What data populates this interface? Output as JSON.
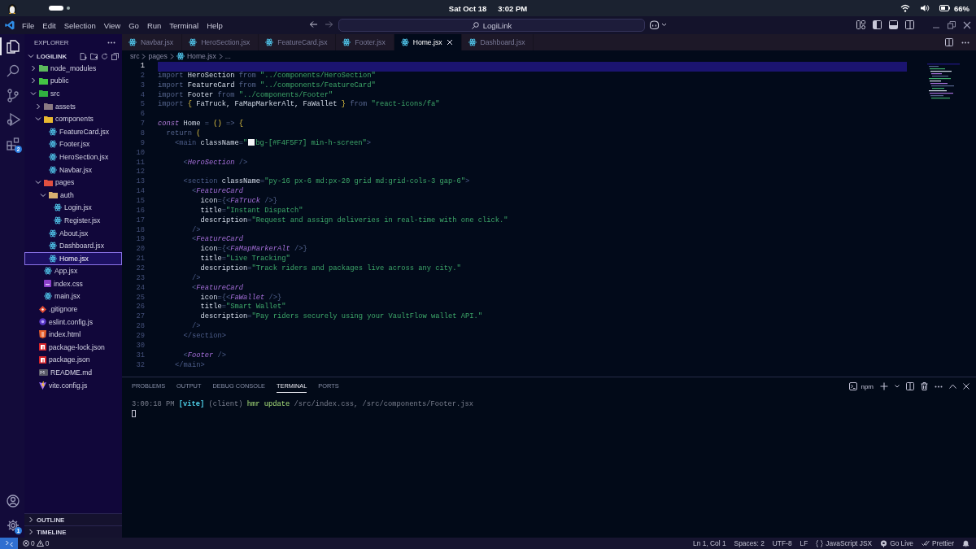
{
  "os_bar": {
    "date": "Sat Oct 18",
    "time": "3:02 PM",
    "battery": "66%"
  },
  "menu": [
    "File",
    "Edit",
    "Selection",
    "View",
    "Go",
    "Run",
    "Terminal",
    "Help"
  ],
  "command_center": {
    "label": "LogiLink"
  },
  "activity_bar": {
    "items": [
      {
        "kind": "explorer",
        "selected": true
      },
      {
        "kind": "search",
        "selected": false
      },
      {
        "kind": "source-control",
        "selected": false
      },
      {
        "kind": "run",
        "selected": false
      },
      {
        "kind": "extensions",
        "selected": false,
        "badge": "2"
      }
    ],
    "bottom": [
      {
        "kind": "account"
      },
      {
        "kind": "settings",
        "badge": "1"
      }
    ]
  },
  "explorer": {
    "title": "EXPLORER",
    "workspace": "LOGILINK",
    "tree": [
      {
        "name": "node_modules",
        "kind": "folder",
        "color": "#5cb85c",
        "expanded": false,
        "selected": false
      },
      {
        "name": "public",
        "kind": "folder",
        "color": "#44c444",
        "expanded": false,
        "selected": false
      },
      {
        "name": "src",
        "kind": "folder",
        "color": "#30b040",
        "expanded": true,
        "selected": false,
        "children": [
          {
            "name": "assets",
            "kind": "folder",
            "color": "#8a7a82",
            "expanded": false,
            "selected": false
          },
          {
            "name": "components",
            "kind": "folder",
            "color": "#e8b830",
            "expanded": true,
            "selected": false,
            "children": [
              {
                "name": "FeatureCard.jsx",
                "kind": "react",
                "selected": false
              },
              {
                "name": "Footer.jsx",
                "kind": "react",
                "selected": false
              },
              {
                "name": "HeroSection.jsx",
                "kind": "react",
                "selected": false
              },
              {
                "name": "Navbar.jsx",
                "kind": "react",
                "selected": false
              }
            ]
          },
          {
            "name": "pages",
            "kind": "folder",
            "color": "#e05040",
            "expanded": true,
            "selected": false,
            "children": [
              {
                "name": "auth",
                "kind": "folder",
                "color": "#d8b070",
                "expanded": true,
                "selected": false,
                "children": [
                  {
                    "name": "Login.jsx",
                    "kind": "react",
                    "selected": false
                  },
                  {
                    "name": "Register.jsx",
                    "kind": "react",
                    "selected": false
                  }
                ]
              },
              {
                "name": "About.jsx",
                "kind": "react",
                "selected": false
              },
              {
                "name": "Dashboard.jsx",
                "kind": "react",
                "selected": false
              },
              {
                "name": "Home.jsx",
                "kind": "react",
                "selected": true
              }
            ]
          },
          {
            "name": "App.jsx",
            "kind": "react",
            "selected": false
          },
          {
            "name": "index.css",
            "kind": "css",
            "selected": false
          },
          {
            "name": "main.jsx",
            "kind": "react",
            "selected": false
          }
        ]
      },
      {
        "name": ".gitignore",
        "kind": "git",
        "selected": false
      },
      {
        "name": "eslint.config.js",
        "kind": "eslint",
        "selected": false
      },
      {
        "name": "index.html",
        "kind": "html",
        "selected": false
      },
      {
        "name": "package-lock.json",
        "kind": "npm",
        "selected": false
      },
      {
        "name": "package.json",
        "kind": "npm",
        "selected": false
      },
      {
        "name": "README.md",
        "kind": "markdown",
        "selected": false
      },
      {
        "name": "vite.config.js",
        "kind": "vite",
        "selected": false
      }
    ],
    "sections": [
      {
        "label": "OUTLINE",
        "expanded": false
      },
      {
        "label": "TIMELINE",
        "expanded": false
      }
    ]
  },
  "tabs": [
    {
      "label": "Navbar.jsx",
      "selected": false
    },
    {
      "label": "HeroSection.jsx",
      "selected": false
    },
    {
      "label": "FeatureCard.jsx",
      "selected": false
    },
    {
      "label": "Footer.jsx",
      "selected": false
    },
    {
      "label": "Home.jsx",
      "selected": true
    },
    {
      "label": "Dashboard.jsx",
      "selected": false
    }
  ],
  "breadcrumb": [
    "src",
    "pages",
    "Home.jsx",
    "..."
  ],
  "editor": {
    "lines": [
      {
        "number": "1",
        "current": true
      },
      {
        "number": "2",
        "current": false,
        "tokens": [
          {
            "kind": "kw",
            "text": "import "
          },
          {
            "kind": "id",
            "text": "HeroSection "
          },
          {
            "kind": "kw",
            "text": "from "
          },
          {
            "kind": "str",
            "text": "\"../components/HeroSection\""
          }
        ]
      },
      {
        "number": "3",
        "current": false,
        "tokens": [
          {
            "kind": "kw",
            "text": "import "
          },
          {
            "kind": "id",
            "text": "FeatureCard "
          },
          {
            "kind": "kw",
            "text": "from "
          },
          {
            "kind": "str",
            "text": "\"../components/FeatureCard\""
          }
        ]
      },
      {
        "number": "4",
        "current": false,
        "tokens": [
          {
            "kind": "kw",
            "text": "import "
          },
          {
            "kind": "id",
            "text": "Footer "
          },
          {
            "kind": "kw",
            "text": "from "
          },
          {
            "kind": "str",
            "text": "\"../components/Footer\""
          }
        ]
      },
      {
        "number": "5",
        "current": false,
        "tokens": [
          {
            "kind": "kw",
            "text": "import "
          },
          {
            "kind": "brace",
            "text": "{ "
          },
          {
            "kind": "id",
            "text": "FaTruck, FaMapMarkerAlt, FaWallet "
          },
          {
            "kind": "brace",
            "text": "} "
          },
          {
            "kind": "kw",
            "text": "from "
          },
          {
            "kind": "str",
            "text": "\"react-icons/fa\""
          }
        ]
      },
      {
        "number": "6",
        "current": false
      },
      {
        "number": "7",
        "current": false,
        "tokens": [
          {
            "kind": "storage",
            "text": "const "
          },
          {
            "kind": "id",
            "text": "Home "
          },
          {
            "kind": "op",
            "text": "= "
          },
          {
            "kind": "brace",
            "text": "() "
          },
          {
            "kind": "op",
            "text": "=> "
          },
          {
            "kind": "brace",
            "text": "{"
          }
        ]
      },
      {
        "number": "8",
        "current": false,
        "tokens": [
          {
            "kind": "kw",
            "text": "  return "
          },
          {
            "kind": "brace",
            "text": "("
          }
        ]
      },
      {
        "number": "9",
        "current": false,
        "tokens": [
          {
            "kind": "tag",
            "text": "    <main "
          },
          {
            "kind": "attr",
            "text": "className"
          },
          {
            "kind": "op",
            "text": "="
          },
          {
            "kind": "str",
            "text": "\""
          },
          {
            "kind": "swatch",
            "color": "#f4f5f7"
          },
          {
            "kind": "str",
            "text": "bg-[#F4F5F7] min-h-screen\""
          },
          {
            "kind": "tag",
            "text": ">"
          }
        ]
      },
      {
        "number": "10",
        "current": false
      },
      {
        "number": "11",
        "current": false,
        "tokens": [
          {
            "kind": "tag",
            "text": "      <"
          },
          {
            "kind": "comp",
            "text": "HeroSection"
          },
          {
            "kind": "tag",
            "text": " />"
          }
        ]
      },
      {
        "number": "12",
        "current": false
      },
      {
        "number": "13",
        "current": false,
        "tokens": [
          {
            "kind": "tag",
            "text": "      <section "
          },
          {
            "kind": "attr",
            "text": "className"
          },
          {
            "kind": "op",
            "text": "="
          },
          {
            "kind": "str",
            "text": "\"py-16 px-6 md:px-20 grid md:grid-cols-3 gap-6\""
          },
          {
            "kind": "tag",
            "text": ">"
          }
        ]
      },
      {
        "number": "14",
        "current": false,
        "tokens": [
          {
            "kind": "tag",
            "text": "        <"
          },
          {
            "kind": "comp",
            "text": "FeatureCard"
          }
        ]
      },
      {
        "number": "15",
        "current": false,
        "tokens": [
          {
            "kind": "attr",
            "text": "          icon"
          },
          {
            "kind": "op",
            "text": "={"
          },
          {
            "kind": "tag",
            "text": "<"
          },
          {
            "kind": "comp",
            "text": "FaTruck"
          },
          {
            "kind": "tag",
            "text": " />"
          },
          {
            "kind": "op",
            "text": "}"
          }
        ]
      },
      {
        "number": "16",
        "current": false,
        "tokens": [
          {
            "kind": "attr",
            "text": "          title"
          },
          {
            "kind": "op",
            "text": "="
          },
          {
            "kind": "str",
            "text": "\"Instant Dispatch\""
          }
        ]
      },
      {
        "number": "17",
        "current": false,
        "tokens": [
          {
            "kind": "attr",
            "text": "          description"
          },
          {
            "kind": "op",
            "text": "="
          },
          {
            "kind": "str",
            "text": "\"Request and assign deliveries in real-time with one click.\""
          }
        ]
      },
      {
        "number": "18",
        "current": false,
        "tokens": [
          {
            "kind": "tag",
            "text": "        />"
          }
        ]
      },
      {
        "number": "19",
        "current": false,
        "tokens": [
          {
            "kind": "tag",
            "text": "        <"
          },
          {
            "kind": "comp",
            "text": "FeatureCard"
          }
        ]
      },
      {
        "number": "20",
        "current": false,
        "tokens": [
          {
            "kind": "attr",
            "text": "          icon"
          },
          {
            "kind": "op",
            "text": "={"
          },
          {
            "kind": "tag",
            "text": "<"
          },
          {
            "kind": "comp",
            "text": "FaMapMarkerAlt"
          },
          {
            "kind": "tag",
            "text": " />"
          },
          {
            "kind": "op",
            "text": "}"
          }
        ]
      },
      {
        "number": "21",
        "current": false,
        "tokens": [
          {
            "kind": "attr",
            "text": "          title"
          },
          {
            "kind": "op",
            "text": "="
          },
          {
            "kind": "str",
            "text": "\"Live Tracking\""
          }
        ]
      },
      {
        "number": "22",
        "current": false,
        "tokens": [
          {
            "kind": "attr",
            "text": "          description"
          },
          {
            "kind": "op",
            "text": "="
          },
          {
            "kind": "str",
            "text": "\"Track riders and packages live across any city.\""
          }
        ]
      },
      {
        "number": "23",
        "current": false,
        "tokens": [
          {
            "kind": "tag",
            "text": "        />"
          }
        ]
      },
      {
        "number": "24",
        "current": false,
        "tokens": [
          {
            "kind": "tag",
            "text": "        <"
          },
          {
            "kind": "comp",
            "text": "FeatureCard"
          }
        ]
      },
      {
        "number": "25",
        "current": false,
        "tokens": [
          {
            "kind": "attr",
            "text": "          icon"
          },
          {
            "kind": "op",
            "text": "={"
          },
          {
            "kind": "tag",
            "text": "<"
          },
          {
            "kind": "comp",
            "text": "FaWallet"
          },
          {
            "kind": "tag",
            "text": " />"
          },
          {
            "kind": "op",
            "text": "}"
          }
        ]
      },
      {
        "number": "26",
        "current": false,
        "tokens": [
          {
            "kind": "attr",
            "text": "          title"
          },
          {
            "kind": "op",
            "text": "="
          },
          {
            "kind": "str",
            "text": "\"Smart Wallet\""
          }
        ]
      },
      {
        "number": "27",
        "current": false,
        "tokens": [
          {
            "kind": "attr",
            "text": "          description"
          },
          {
            "kind": "op",
            "text": "="
          },
          {
            "kind": "str",
            "text": "\"Pay riders securely using your VaultFlow wallet API.\""
          }
        ]
      },
      {
        "number": "28",
        "current": false,
        "tokens": [
          {
            "kind": "tag",
            "text": "        />"
          }
        ]
      },
      {
        "number": "29",
        "current": false,
        "tokens": [
          {
            "kind": "tag",
            "text": "      </section>"
          }
        ]
      },
      {
        "number": "30",
        "current": false
      },
      {
        "number": "31",
        "current": false,
        "tokens": [
          {
            "kind": "tag",
            "text": "      <"
          },
          {
            "kind": "comp",
            "text": "Footer"
          },
          {
            "kind": "tag",
            "text": " />"
          }
        ]
      },
      {
        "number": "32",
        "current": false,
        "tokens": [
          {
            "kind": "tag",
            "text": "    </main>"
          }
        ]
      }
    ]
  },
  "panel": {
    "tabs": [
      {
        "label": "PROBLEMS",
        "selected": false
      },
      {
        "label": "OUTPUT",
        "selected": false
      },
      {
        "label": "DEBUG CONSOLE",
        "selected": false
      },
      {
        "label": "TERMINAL",
        "selected": true
      },
      {
        "label": "PORTS",
        "selected": false
      }
    ],
    "terminal_profile": "npm",
    "terminal_lines": [
      {
        "tokens": [
          {
            "kind": "dim",
            "text": "3:00:18 PM "
          },
          {
            "kind": "tool",
            "text": "[vite]"
          },
          {
            "kind": "dim",
            "text": " (client) "
          },
          {
            "kind": "ok",
            "text": "hmr update "
          },
          {
            "kind": "dim",
            "text": "/src/index.css, /src/components/Footer.jsx"
          }
        ]
      }
    ]
  },
  "status_bar": {
    "errors": "0",
    "warnings": "0",
    "items": [
      {
        "kind": "plain",
        "text": "Ln 1, Col 1"
      },
      {
        "kind": "plain",
        "text": "Spaces: 2"
      },
      {
        "kind": "plain",
        "text": "UTF-8"
      },
      {
        "kind": "plain",
        "text": "LF"
      },
      {
        "kind": "language",
        "text": "JavaScript JSX"
      },
      {
        "kind": "live",
        "text": "Go Live"
      },
      {
        "kind": "prettier",
        "text": "Prettier"
      }
    ]
  }
}
